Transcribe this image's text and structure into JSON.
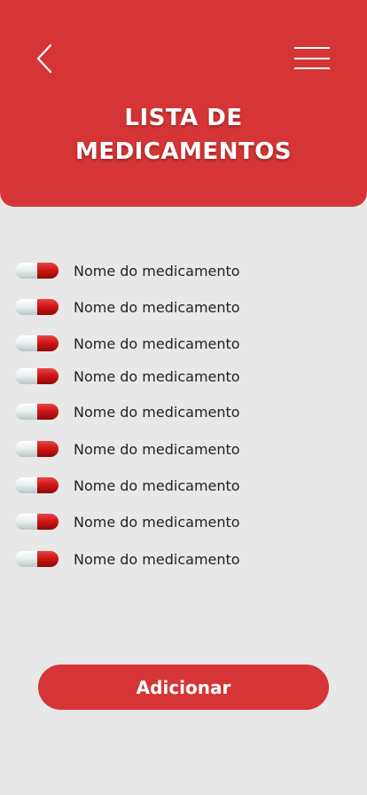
{
  "header": {
    "title_line1": "LISTA DE",
    "title_line2": "MEDICAMENTOS",
    "back_icon": "chevron-left-icon",
    "menu_icon": "hamburger-menu-icon"
  },
  "medications": [
    {
      "label": "Nome do medicamento"
    },
    {
      "label": "Nome do medicamento"
    },
    {
      "label": "Nome do medicamento"
    },
    {
      "label": "Nome do medicamento"
    },
    {
      "label": "Nome do medicamento"
    },
    {
      "label": "Nome do medicamento"
    },
    {
      "label": "Nome do medicamento"
    },
    {
      "label": "Nome do medicamento"
    },
    {
      "label": "Nome do medicamento"
    }
  ],
  "add_button": {
    "label": "Adicionar"
  },
  "colors": {
    "accent": "#d63535",
    "background": "#e8e8e8",
    "pill_red": "#c91a1a",
    "pill_white": "#eef3f3"
  }
}
